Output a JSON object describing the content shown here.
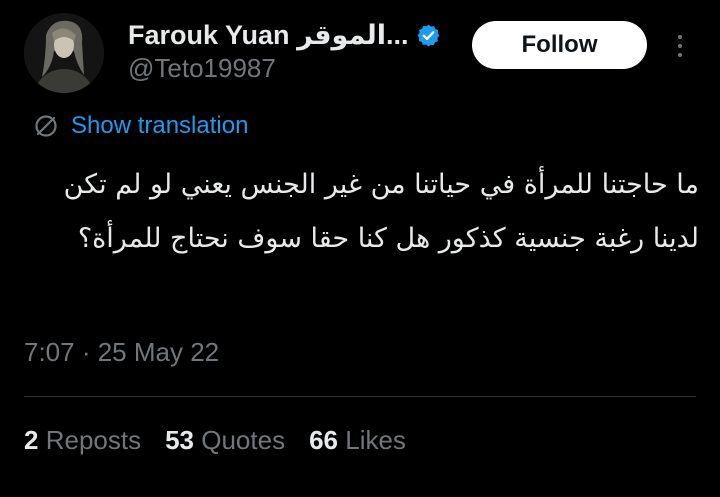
{
  "author": {
    "display_name": "Farouk Yuan الموقر...",
    "handle": "@Teto19987",
    "verified": true,
    "verified_color": "#1d9bf0"
  },
  "follow_button": {
    "label": "Follow"
  },
  "more_button": {
    "icon": "more-vertical-icon"
  },
  "translation": {
    "icon": "translate-icon",
    "label": "Show translation",
    "color": "#1d9bf0"
  },
  "tweet": {
    "text": "ما حاجتنا للمرأة في حياتنا من غير الجنس يعني لو لم تكن لدينا رغبة جنسية كذكور هل كنا حقا سوف نحتاج للمرأة؟",
    "timestamp": "7:07 · 25 May 22"
  },
  "stats": {
    "reposts": {
      "count": "2",
      "label": "Reposts"
    },
    "quotes": {
      "count": "53",
      "label": "Quotes"
    },
    "likes": {
      "count": "66",
      "label": "Likes"
    }
  },
  "colors": {
    "background": "#000000",
    "text_primary": "#e7e9ea",
    "text_secondary": "#71767b",
    "divider": "#2f3336"
  }
}
